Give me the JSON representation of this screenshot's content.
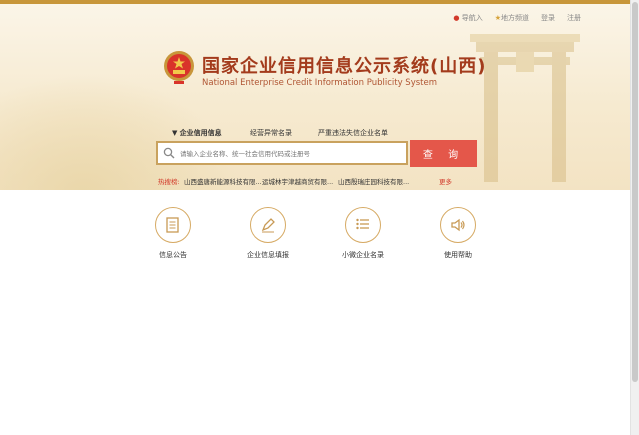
{
  "topnav": {
    "nav_label": "导航入",
    "region_label": "地方频道",
    "login": "登录",
    "register": "注册"
  },
  "header": {
    "title_cn": "国家企业信用信息公示系统(山西)",
    "title_en": "National Enterprise Credit Information Publicity System"
  },
  "tabs": [
    {
      "label": "企业信用信息"
    },
    {
      "label": "经营异常名录"
    },
    {
      "label": "严重违法失信企业名单"
    }
  ],
  "search": {
    "placeholder": "请输入企业名称、统一社会信用代码或注册号",
    "button_label": "查 询"
  },
  "hot": {
    "label": "热搜榜:",
    "items": [
      "山西盛唐新能源科技有限...",
      "运城林宇津越商贸有限...",
      "山西殷瑞庄园科技有限..."
    ],
    "more": "更多"
  },
  "services": [
    {
      "label": "信息公告",
      "icon": "document-icon"
    },
    {
      "label": "企业信息填报",
      "icon": "pen-icon"
    },
    {
      "label": "小微企业名录",
      "icon": "list-icon"
    },
    {
      "label": "使用帮助",
      "icon": "speaker-icon"
    }
  ],
  "colors": {
    "accent": "#c8963a",
    "title": "#a33b1c",
    "button": "#e4574a",
    "hot": "#d23a2b"
  }
}
